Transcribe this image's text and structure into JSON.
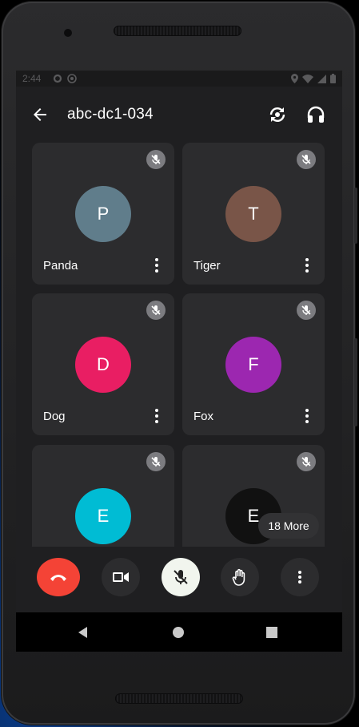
{
  "status_bar": {
    "time": "2:44",
    "icons": [
      "settings-icon",
      "cast-icon",
      "location-icon",
      "wifi-icon",
      "signal-icon",
      "battery-icon"
    ]
  },
  "app_bar": {
    "title": "abc-dc1-034",
    "icons": [
      "back-arrow-icon",
      "switch-camera-icon",
      "headphones-icon"
    ]
  },
  "participants": [
    {
      "initial": "P",
      "name": "Panda",
      "avatar_color": "#607d8b",
      "muted": true
    },
    {
      "initial": "T",
      "name": "Tiger",
      "avatar_color": "#795548",
      "muted": true
    },
    {
      "initial": "D",
      "name": "Dog",
      "avatar_color": "#e91e63",
      "muted": true
    },
    {
      "initial": "F",
      "name": "Fox",
      "avatar_color": "#9c27b0",
      "muted": true
    },
    {
      "initial": "E",
      "name": "",
      "avatar_color": "#00bcd4",
      "muted": true
    },
    {
      "initial": "E",
      "name": "",
      "avatar_color": "#111111",
      "muted": true
    }
  ],
  "more_label": "18 More",
  "controls": {
    "end_call_color": "#f44336",
    "mic_bg_color": "#f1f5ee",
    "icons": [
      "end-call-icon",
      "video-camera-icon",
      "mic-off-icon",
      "raise-hand-icon",
      "more-vert-icon"
    ]
  },
  "nav_bar": {
    "icons": [
      "nav-back-icon",
      "nav-home-icon",
      "nav-recents-icon"
    ]
  }
}
